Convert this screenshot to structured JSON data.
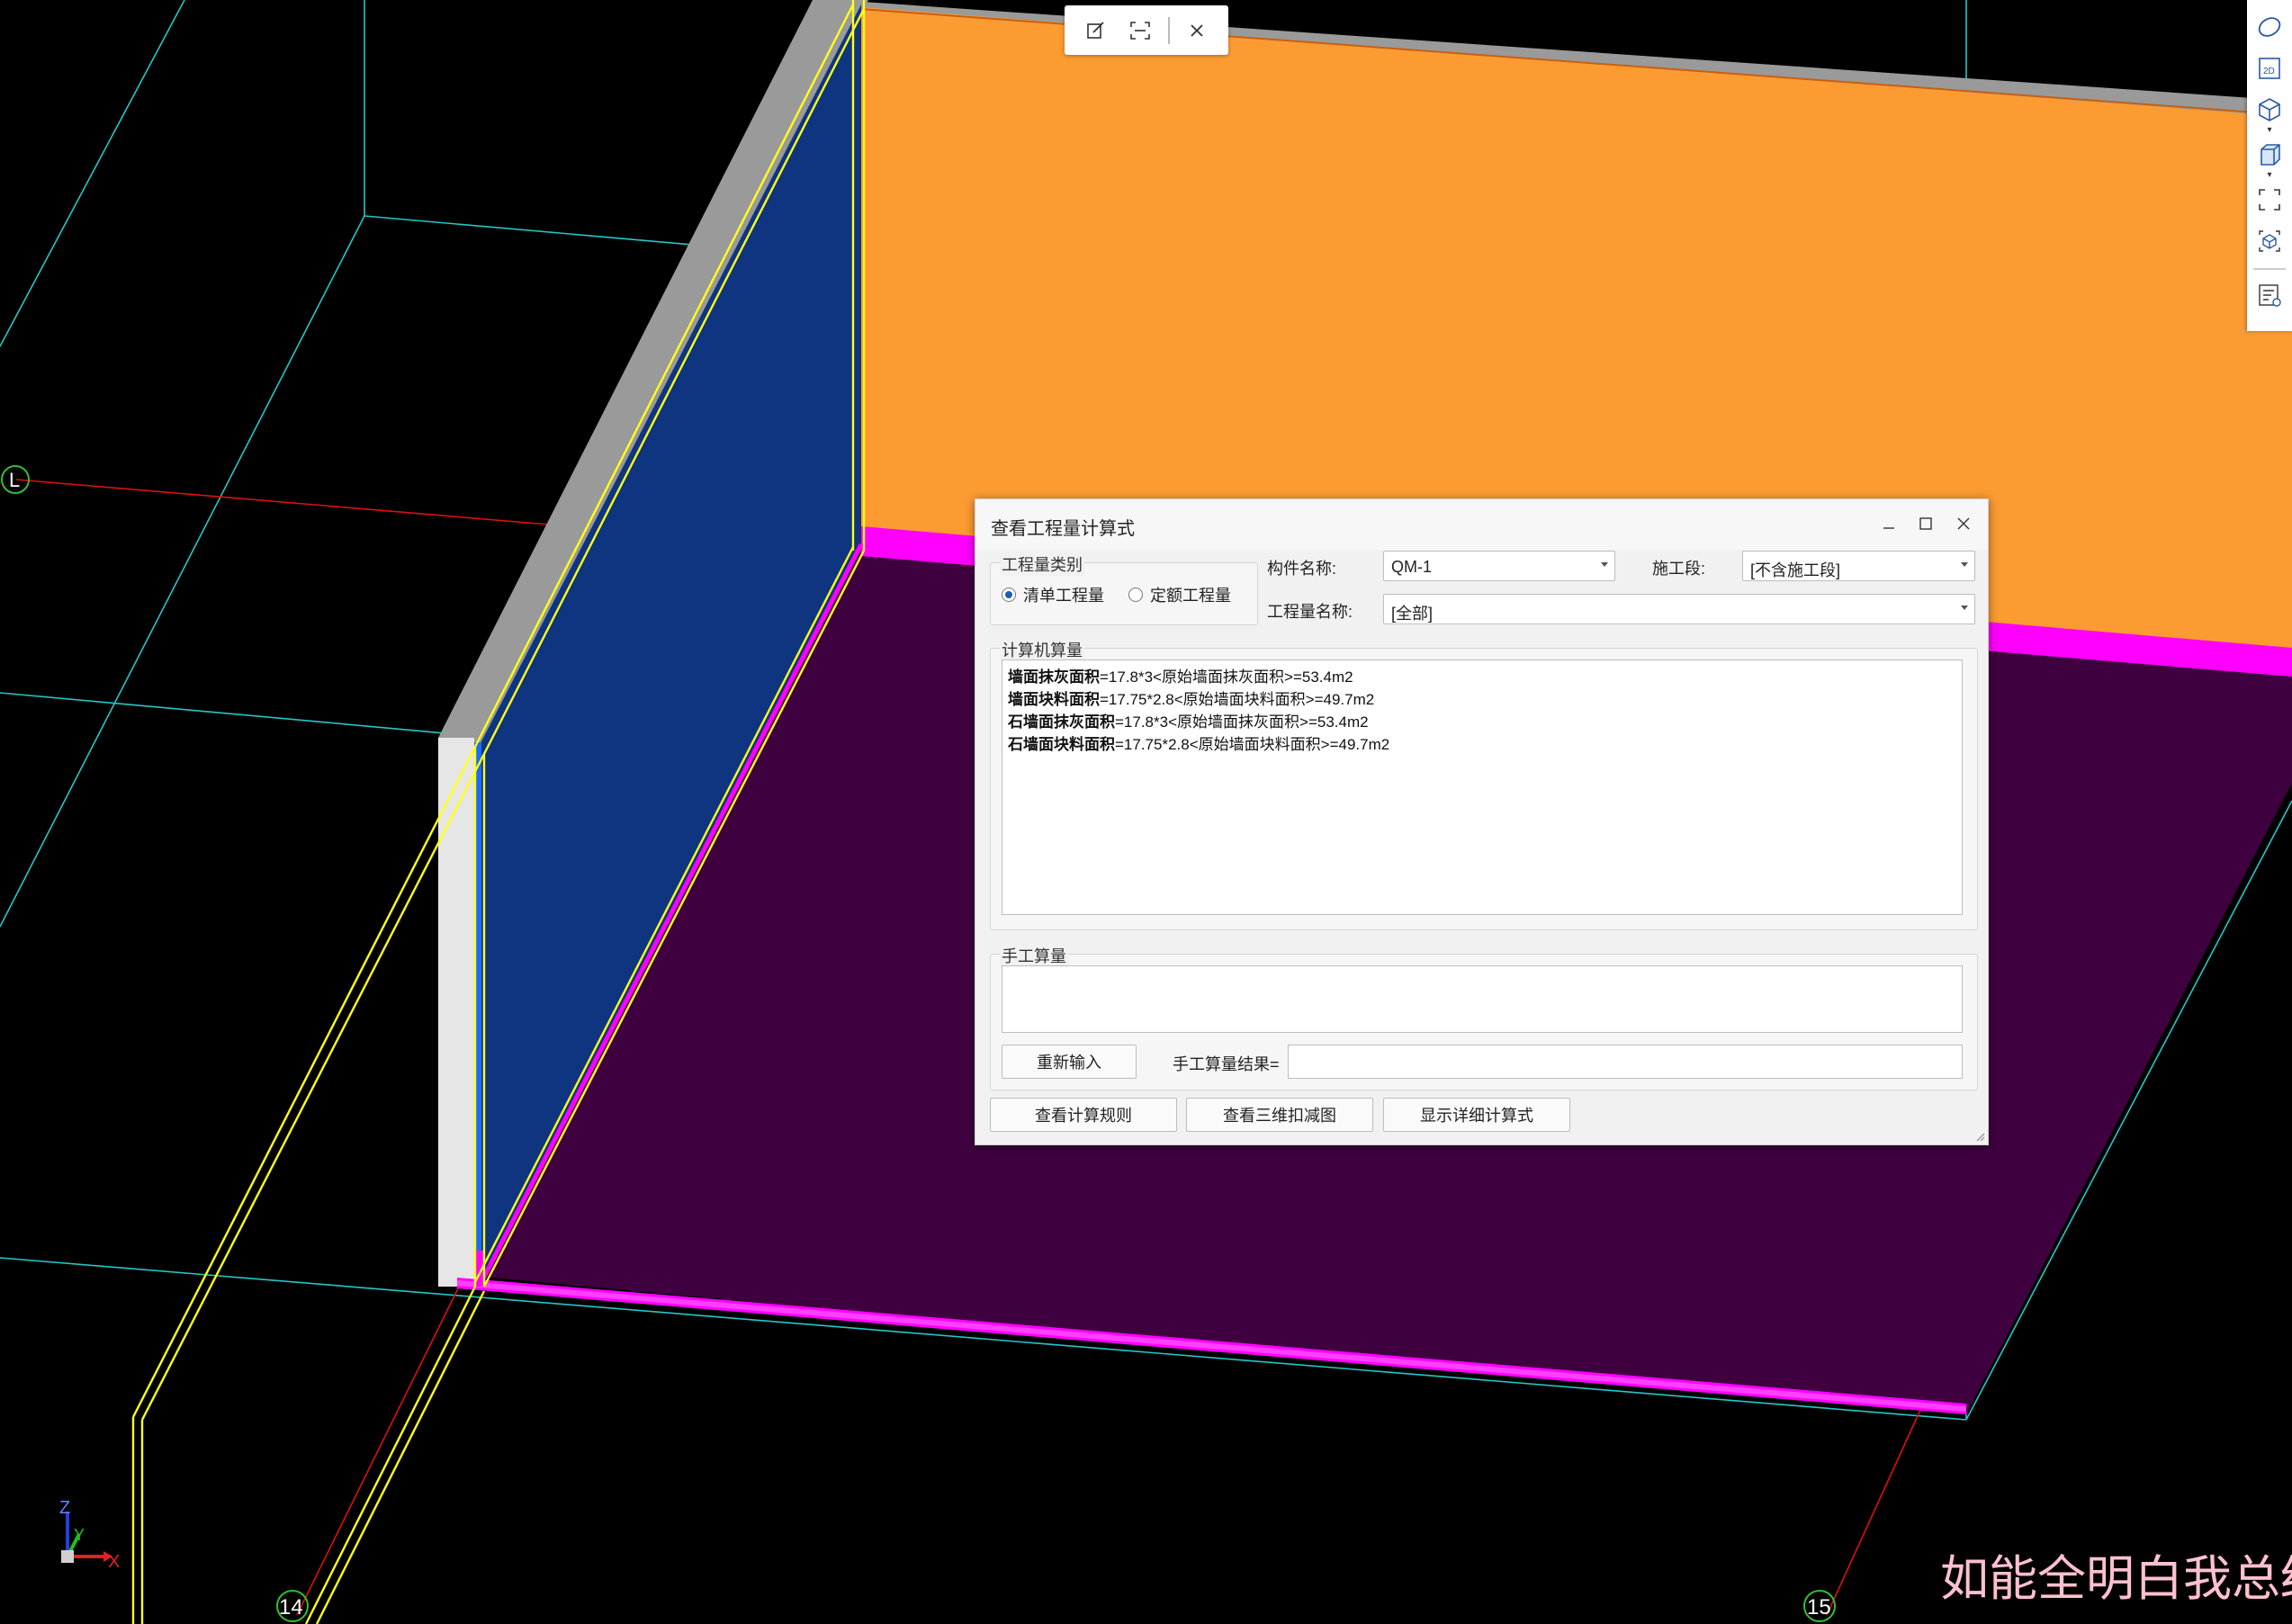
{
  "floating_toolbar": {
    "buttons": [
      "edit-icon",
      "scan-icon",
      "close-icon"
    ]
  },
  "right_toolbar": {
    "buttons": [
      "orbit-icon",
      "2d-view-icon",
      "3d-cube-icon",
      "box-view-icon",
      "fullscreen-icon",
      "dynamic-view-icon",
      "property-list-icon"
    ],
    "labels": {
      "two_d": "2D"
    }
  },
  "viewport": {
    "grid_labels": {
      "row_l": "L",
      "col_14": "14",
      "col_15": "15"
    },
    "axes": {
      "x": "X",
      "y": "Y",
      "z": "Z"
    },
    "colors": {
      "wall_top": "#9a9a9a",
      "wall_face_blue": "#0f3580",
      "orange_wall": "#fb9b32",
      "floor": "#3f003f",
      "magenta_edge": "#ff00ff",
      "yellow_outline": "#ffff1a",
      "grid_cyan": "#22c8c8",
      "axis_red": "#dd1010"
    }
  },
  "dialog": {
    "title": "查看工程量计算式",
    "quantity_type": {
      "legend": "工程量类别",
      "options": [
        {
          "label": "清单工程量",
          "selected": true
        },
        {
          "label": "定额工程量",
          "selected": false
        }
      ]
    },
    "component_name": {
      "label": "构件名称:",
      "value": "QM-1"
    },
    "construction_stage": {
      "label": "施工段:",
      "value": "[不含施工段]"
    },
    "quantity_name": {
      "label": "工程量名称:",
      "value": "[全部]"
    },
    "computer_calc": {
      "legend": "计算机算量",
      "lines": [
        {
          "name": "墙面抹灰面积",
          "expr": "=17.8*3<原始墙面抹灰面积>=53.4m2"
        },
        {
          "name": "墙面块料面积",
          "expr": "=17.75*2.8<原始墙面块料面积>=49.7m2"
        },
        {
          "name": "石墙面抹灰面积",
          "expr": "=17.8*3<原始墙面抹灰面积>=53.4m2"
        },
        {
          "name": "石墙面块料面积",
          "expr": "=17.75*2.8<原始墙面块料面积>=49.7m2"
        }
      ]
    },
    "manual_calc": {
      "legend": "手工算量",
      "reenter_label": "重新输入",
      "result_label": "手工算量结果=",
      "result_value": ""
    },
    "buttons": {
      "rules": "查看计算规则",
      "deduction_3d": "查看三维扣减图",
      "detailed": "显示详细计算式"
    }
  },
  "subtitle": "如能全明白我总结"
}
